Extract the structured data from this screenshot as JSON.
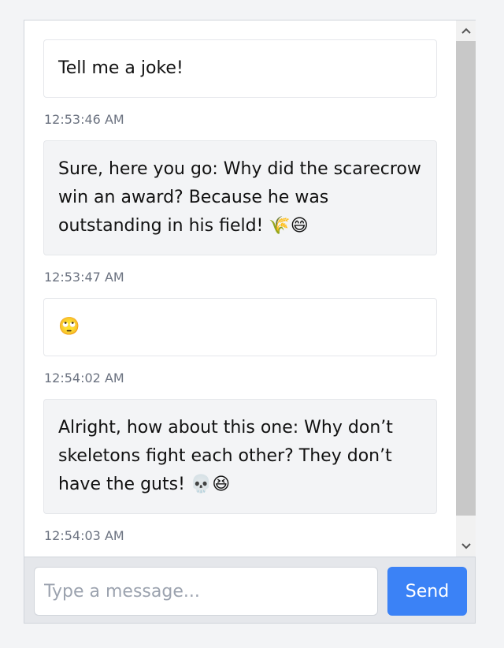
{
  "messages": [
    {
      "role": "user",
      "text": "Tell me a joke!",
      "time": "12:53:46 AM"
    },
    {
      "role": "bot",
      "text": "Sure, here you go: Why did the scarecrow win an award? Because he was outstanding in his field!",
      "emojis": [
        "🌾",
        "😄"
      ],
      "time": "12:53:47 AM"
    },
    {
      "role": "user",
      "text": "",
      "emojis": [
        "🙄"
      ],
      "time": "12:54:02 AM"
    },
    {
      "role": "bot",
      "text": "Alright, how about this one: Why don’t skeletons fight each other? They don’t have the guts!",
      "emojis": [
        "💀",
        "😆"
      ],
      "time": "12:54:03 AM"
    }
  ],
  "input": {
    "placeholder": "Type a message...",
    "value": ""
  },
  "send_label": "Send",
  "icons": {
    "scroll_up": "chevron-up-icon",
    "scroll_down": "chevron-down-icon"
  },
  "colors": {
    "accent": "#3b82f6",
    "bot_bubble": "#f3f4f6",
    "user_bubble": "#ffffff",
    "timestamp": "#6b7280"
  }
}
